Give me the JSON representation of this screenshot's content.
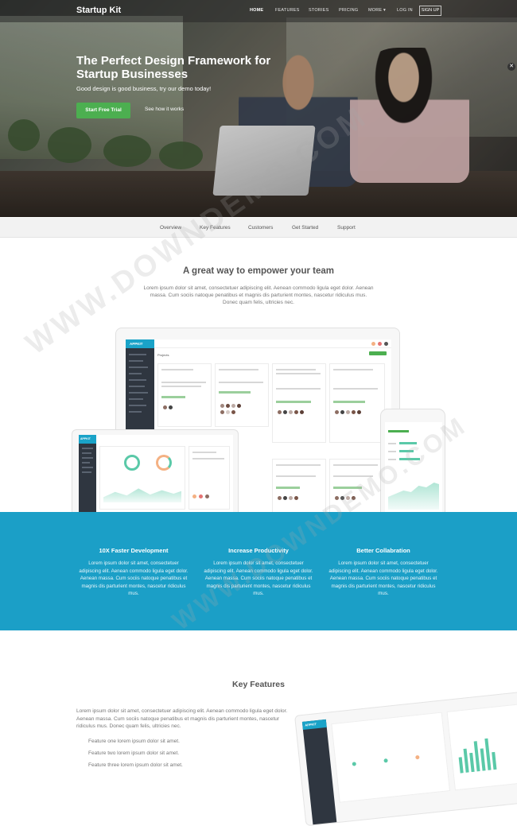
{
  "navbar": {
    "brand": "Startup Kit",
    "items": [
      {
        "label": "HOME",
        "active": true
      },
      {
        "label": "FEATURES",
        "active": false
      },
      {
        "label": "STORIES",
        "active": false
      },
      {
        "label": "PRICING",
        "active": false
      },
      {
        "label": "MORE",
        "active": false
      },
      {
        "label": "LOG IN",
        "active": false
      }
    ],
    "more_caret": "▾",
    "signup": "SIGN UP"
  },
  "hero": {
    "title": "The Perfect Design Framework for Startup Businesses",
    "subtitle": "Good design is good business, try our demo today!",
    "cta": "Start Free Trial",
    "link": "See how it works",
    "close": "✕"
  },
  "subnav": [
    "Overview",
    "Key Features",
    "Customers",
    "Get Started",
    "Support"
  ],
  "intro": {
    "title": "A great way to empower your team",
    "text": "Lorem ipsum dolor sit amet, consectetuer adipiscing elit. Aenean commodo ligula eget dolor. Aenean massa. Cum sociis natoque penatibus et magnis dis parturient montes, nascetur ridiculus mus. Donec quam felis, ultricies nec."
  },
  "mockup": {
    "logo": "APPKIT",
    "projects_label": "Projects",
    "small_logo": "APPKIT"
  },
  "features_band": [
    {
      "title": "10X Faster Development",
      "text": "Lorem ipsum dolor sit amet, consectetuer adipiscing elit. Aenean commodo ligula eget dolor. Aenean massa. Cum sociis natoque penatibus et magnis dis parturient montes, nascetur ridiculus mus."
    },
    {
      "title": "Increase Productivity",
      "text": "Lorem ipsum dolor sit amet, consectetuer adipiscing elit. Aenean commodo ligula eget dolor. Aenean massa. Cum sociis natoque penatibus et magnis dis parturient montes, nascetur ridiculus mus."
    },
    {
      "title": "Better Collabration",
      "text": "Lorem ipsum dolor sit amet, consectetuer adipiscing elit. Aenean commodo ligula eget dolor. Aenean massa. Cum sociis natoque penatibus et magnis dis parturient montes, nascetur ridiculus mus."
    }
  ],
  "key_features": {
    "title": "Key Features",
    "text": "Lorem ipsum dolor sit amet, consectetuer adipiscing elit. Aenean commodo ligula eget dolor. Aenean massa. Cum sociis natoque penatibus et magnis dis parturient montes, nascetur ridiculus mus. Donec quam felis, ultricies nec.",
    "items": [
      "Feature one lorem ipsum dolor sit amet.",
      "Feature two lorem ipsum dolor sit amet.",
      "Feature three lorem ipsum dolor sit amet."
    ]
  },
  "watermark": "WWW.DOWNDEMO.COM",
  "colors": {
    "accent_green": "#4caf50",
    "band_blue": "#1b9fc7",
    "app_teal": "#1aa3c8"
  }
}
